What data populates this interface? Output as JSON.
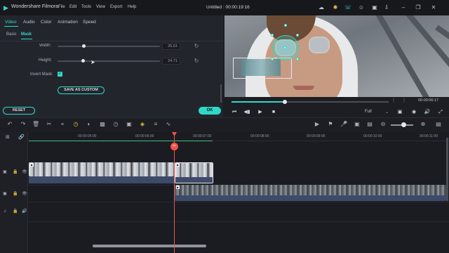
{
  "titlebar": {
    "app_name": "Wondershare Filmora",
    "menu": [
      "File",
      "Edit",
      "Tools",
      "View",
      "Export",
      "Help"
    ],
    "project_title": "Untitled : 00:00:19:16"
  },
  "left_panel": {
    "tabs": [
      "Video",
      "Audio",
      "Color",
      "Animation",
      "Speed"
    ],
    "active_tab": "Video",
    "subtabs": [
      "Basic",
      "Mask"
    ],
    "active_subtab": "Mask",
    "width_label": "Width:",
    "width_value": "25.61",
    "height_label": "Height:",
    "height_value": "24.71",
    "invert_mask_label": "Invert Mask:",
    "invert_mask_checked": true,
    "save_as_custom": "SAVE AS CUSTOM",
    "reset": "RESET",
    "ok": "OK"
  },
  "preview": {
    "timecode": "00:00:06:17",
    "quality": "Full",
    "progress_fraction": 0.34
  },
  "timeline": {
    "ruler_labels": [
      "00:00:05:00",
      "00:00:06:00",
      "00:00:07:00",
      "00:00:08:00",
      "00:00:09:00",
      "00:00:10:00",
      "00:00:11:00"
    ]
  },
  "colors": {
    "accent": "#2fd9c8",
    "playhead": "#f0524a",
    "keyframe": "#e9c24a",
    "background": "#1d1e24"
  }
}
